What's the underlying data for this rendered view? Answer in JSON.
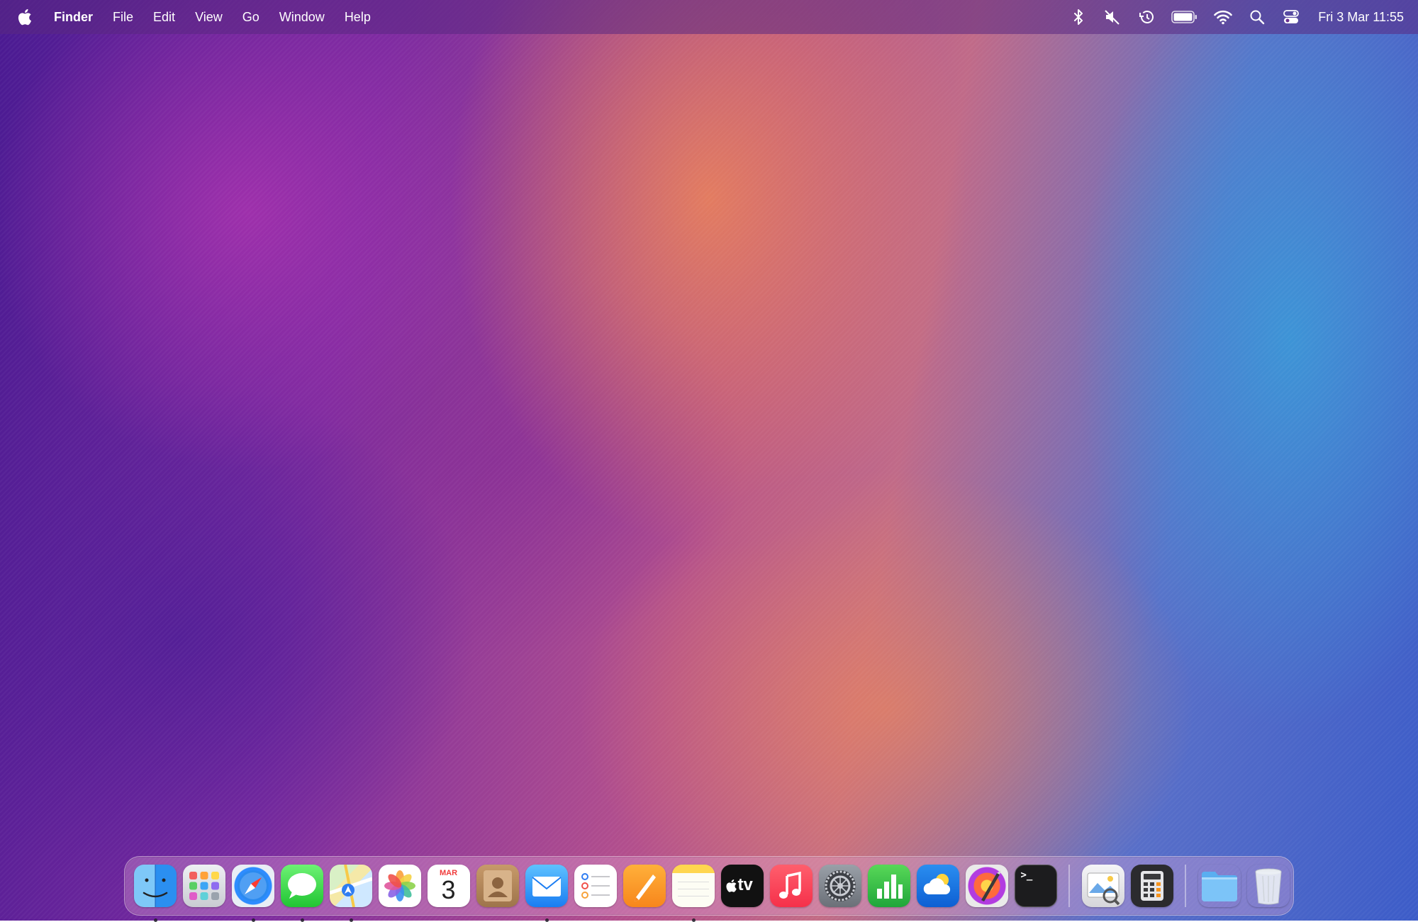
{
  "menubar": {
    "app_name": "Finder",
    "menus": [
      "File",
      "Edit",
      "View",
      "Go",
      "Window",
      "Help"
    ],
    "status_icons": [
      "bluetooth-icon",
      "muted-speaker-icon",
      "time-machine-icon",
      "battery-icon",
      "wifi-icon",
      "spotlight-search-icon",
      "control-center-icon"
    ],
    "clock": "Fri 3 Mar  11:55"
  },
  "dock": {
    "items": [
      {
        "name": "Finder",
        "icon": "finder-icon",
        "running": true
      },
      {
        "name": "Launchpad",
        "icon": "launchpad-icon",
        "running": false
      },
      {
        "name": "Safari",
        "icon": "safari-icon",
        "running": true
      },
      {
        "name": "Messages",
        "icon": "messages-icon",
        "running": true
      },
      {
        "name": "Maps",
        "icon": "maps-icon",
        "running": true
      },
      {
        "name": "Photos",
        "icon": "photos-icon",
        "running": false
      },
      {
        "name": "Calendar",
        "icon": "calendar-icon",
        "running": false
      },
      {
        "name": "Contacts",
        "icon": "contacts-icon",
        "running": false
      },
      {
        "name": "Mail",
        "icon": "mail-icon",
        "running": true
      },
      {
        "name": "Reminders",
        "icon": "reminders-icon",
        "running": false
      },
      {
        "name": "Pages",
        "icon": "pages-icon",
        "running": false
      },
      {
        "name": "Notes",
        "icon": "notes-icon",
        "running": true
      },
      {
        "name": "TV",
        "icon": "apple-tv-icon",
        "running": false
      },
      {
        "name": "Music",
        "icon": "music-icon",
        "running": false
      },
      {
        "name": "System Settings",
        "icon": "system-settings-icon",
        "running": false
      },
      {
        "name": "Numbers",
        "icon": "numbers-icon",
        "running": false
      },
      {
        "name": "Weather",
        "icon": "weather-icon",
        "running": false
      },
      {
        "name": "Pixelmator",
        "icon": "pixelmator-icon",
        "running": false
      },
      {
        "name": "Terminal",
        "icon": "terminal-icon",
        "running": false
      }
    ],
    "recent_items": [
      {
        "name": "Preview",
        "icon": "preview-icon",
        "running": false
      },
      {
        "name": "Calculator",
        "icon": "calculator-icon",
        "running": false
      }
    ],
    "stack_items": [
      {
        "name": "Downloads",
        "icon": "folder-icon"
      },
      {
        "name": "Trash",
        "icon": "trash-icon"
      }
    ],
    "calendar_month": "MAR",
    "calendar_day": "3",
    "tv_label": "tv",
    "terminal_prompt": ">_"
  }
}
